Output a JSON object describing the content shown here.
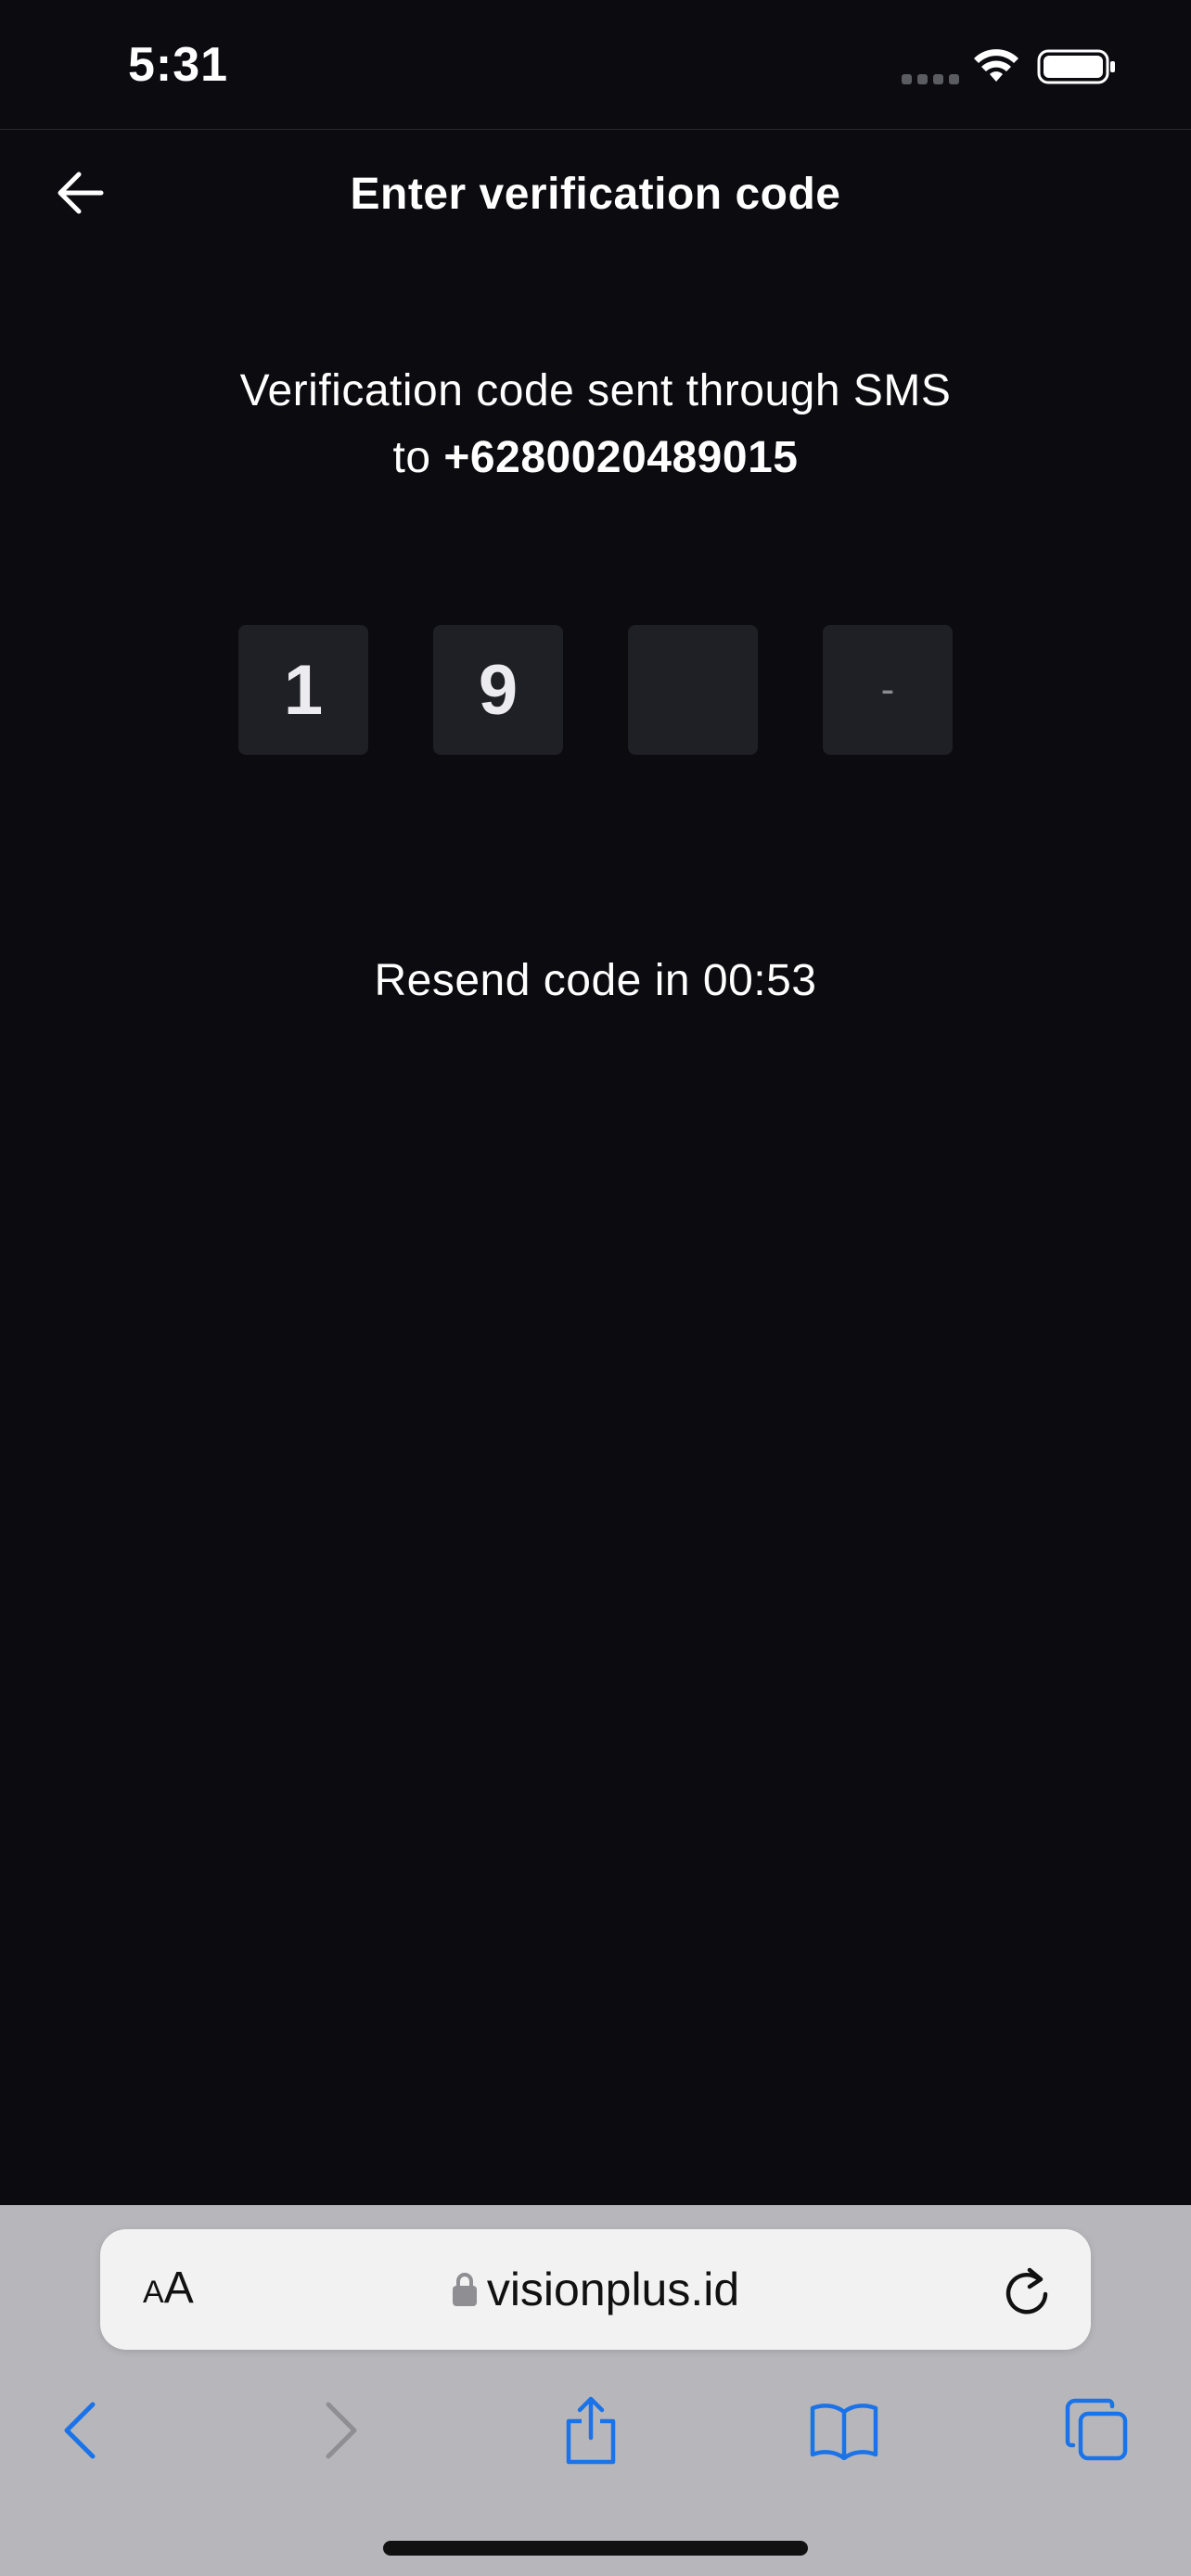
{
  "status_bar": {
    "time": "5:31"
  },
  "header": {
    "title": "Enter verification code"
  },
  "instruction": {
    "line1": "Verification code sent through SMS",
    "to_prefix": "to",
    "phone": "+6280020489015"
  },
  "otp": {
    "digits": [
      "1",
      "9",
      "",
      "-"
    ]
  },
  "resend": {
    "text": "Resend code in 00:53"
  },
  "browser": {
    "text_size_small": "A",
    "text_size_big": "A",
    "url": "visionplus.id",
    "accent_color": "#1a73e8"
  },
  "icons": {
    "back": "arrow-left-icon",
    "wifi": "wifi-icon",
    "battery": "battery-icon",
    "lock": "lock-icon",
    "reload": "reload-icon",
    "nav_back": "chevron-left-icon",
    "nav_forward": "chevron-right-icon",
    "share": "share-icon",
    "bookmarks": "book-icon",
    "tabs": "tabs-icon"
  }
}
